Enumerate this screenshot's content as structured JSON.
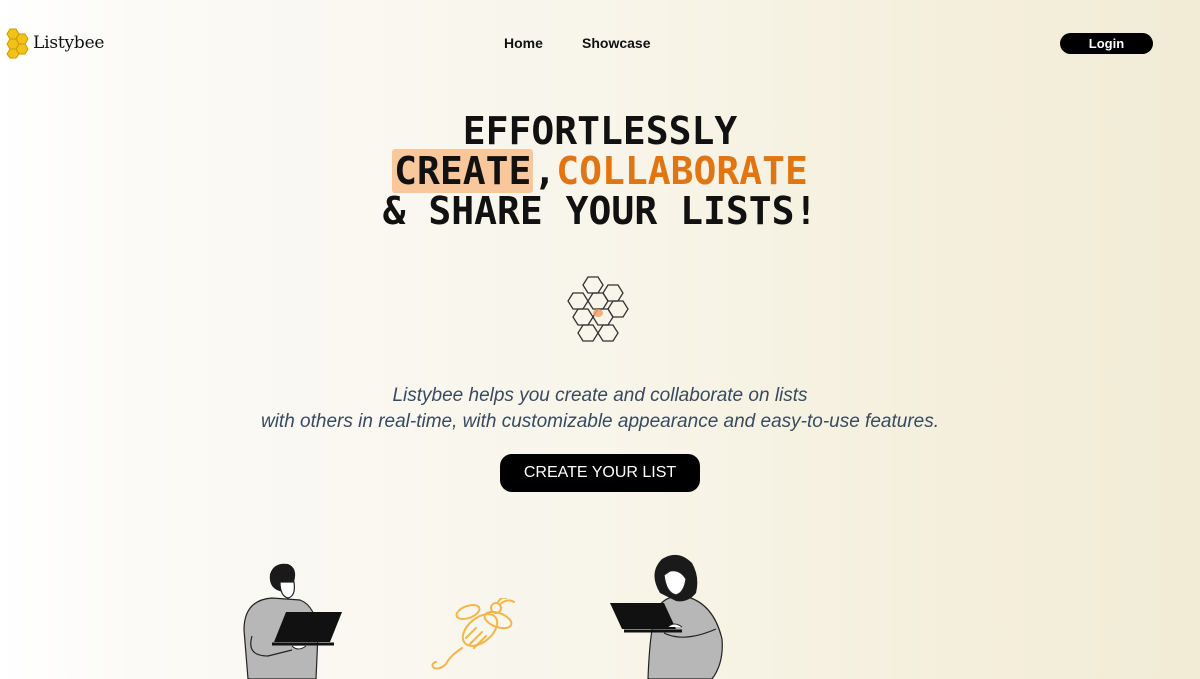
{
  "brand": {
    "name": "Listybee",
    "logo_icon": "honeycomb-logo-icon",
    "accent": "#f3c21a"
  },
  "nav": {
    "items": [
      "Home",
      "Showcase"
    ],
    "login_label": "Login"
  },
  "hero": {
    "line1": "EFFORTLESSLY",
    "create": "CREATE",
    "comma": ",",
    "collaborate": "COLLABORATE",
    "line3": "& SHARE YOUR LISTS!",
    "highlight_color": "#f9c79c",
    "accent_color": "#e07512",
    "hex_icon": "honeycomb-icon",
    "subtitle_line1": "Listybee helps you create and collaborate on lists",
    "subtitle_line2": "with others in real-time, with customizable appearance and easy-to-use features.",
    "cta_label": "CREATE YOUR LIST"
  },
  "illustrations": {
    "left": "man-with-laptop-illustration",
    "center": "bee-illustration",
    "right": "woman-with-laptop-illustration"
  }
}
